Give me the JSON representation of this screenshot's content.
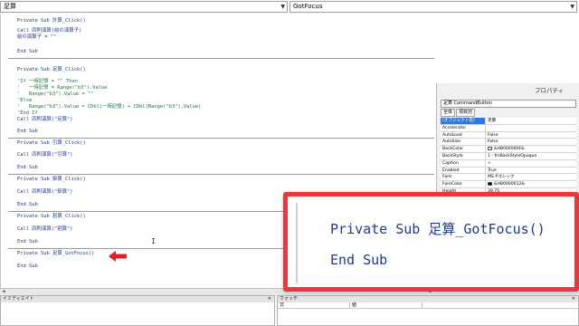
{
  "toolbar": {
    "object_combo": "足算",
    "procedure_combo": "GotFocus"
  },
  "code": {
    "proc1": {
      "line1": "Private Sub 計算_Click()",
      "line2": "Call 四則演算(前の演算子)",
      "line3": "前の演算子 = \"\"",
      "line4": "End Sub"
    },
    "proc2": {
      "line1": "Private Sub 足算_Click()",
      "line2": "'If 一時記憶 = \"\" Then",
      "line3": "'   一時記憶 = Range(\"b3\").Value",
      "line4": "'   Range(\"b3\").Value = \"\"",
      "line5": "'Else",
      "line6": "'   Range(\"b3\").Value = CDbl(一時記憶) + CDbl(Range(\"b3\").Value)",
      "line7": "'End If",
      "line8": "Call 四則演算(\"足算\")",
      "line9": "End Sub"
    },
    "proc3": {
      "line1": "Private Sub 引算_Click()",
      "line2": "Call 四則演算(\"引算\")",
      "line3": "End Sub"
    },
    "proc4": {
      "line1": "Private Sub 掛算_Click()",
      "line2": "Call 四則演算(\"掛算\")",
      "line3": "End Sub"
    },
    "proc5": {
      "line1": "Private Sub 割算_Click()",
      "line2": "Call 四則演算(\"割算\")",
      "line3": "End Sub"
    },
    "proc6": {
      "line1": "Private Sub 足算_GotFocus()",
      "line2": "End Sub"
    }
  },
  "properties": {
    "title": "プロパティ",
    "object": "足算 CommandButton",
    "tabs": [
      "全体",
      "項目別"
    ],
    "rows": [
      {
        "name": "(オブジェクト名)",
        "value": "足算"
      },
      {
        "name": "Accelerator",
        "value": ""
      },
      {
        "name": "AutoLoad",
        "value": "False"
      },
      {
        "name": "AutoSize",
        "value": "False"
      },
      {
        "name": "BackColor",
        "value": "&H8000000F&"
      },
      {
        "name": "BackStyle",
        "value": "1 - fmBackStyleOpaque"
      },
      {
        "name": "Caption",
        "value": "+"
      },
      {
        "name": "Enabled",
        "value": "True"
      },
      {
        "name": "Font",
        "value": "MS Pゴシック"
      },
      {
        "name": "ForeColor",
        "value": "&H80000012&"
      },
      {
        "name": "Height",
        "value": "39.75"
      }
    ],
    "colors": {
      "backcolor": "#f0f0f0",
      "forecolor": "#000000"
    }
  },
  "panes": {
    "immediate_title": "イミディエイト",
    "watch_title": "ウォッチ",
    "watch_columns": [
      "式",
      "値"
    ]
  },
  "callout": {
    "line1": "Private Sub 足算_GotFocus()",
    "line2": "End Sub",
    "border_color": "#e8383c"
  },
  "pointer": {
    "color": "#e02020"
  }
}
